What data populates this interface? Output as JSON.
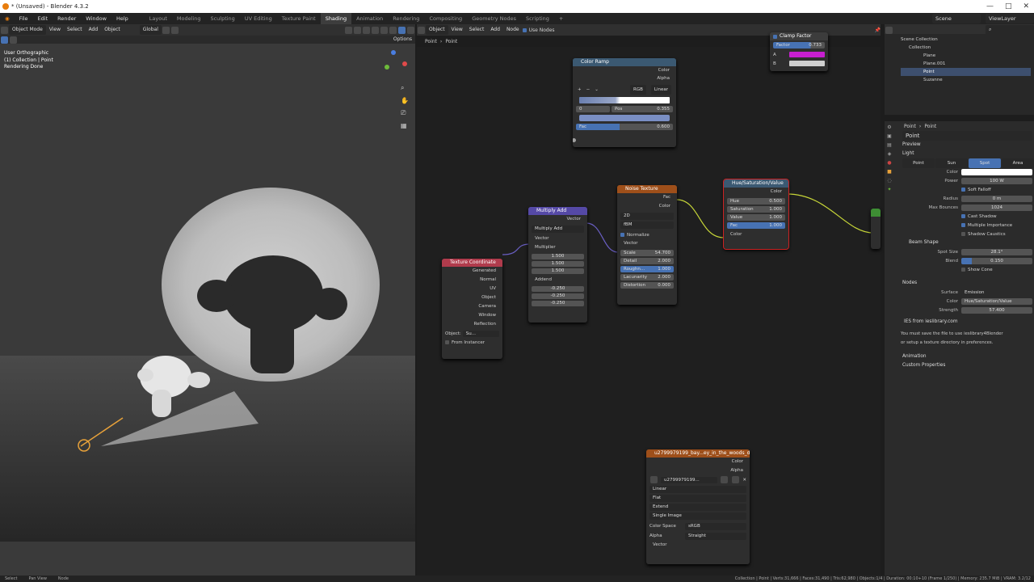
{
  "title": "* (Unsaved) - Blender 4.3.2",
  "menu": [
    "File",
    "Edit",
    "Render",
    "Window",
    "Help"
  ],
  "workspaces": [
    "Layout",
    "Modeling",
    "Sculpting",
    "UV Editing",
    "Texture Paint",
    "Shading",
    "Animation",
    "Rendering",
    "Compositing",
    "Geometry Nodes",
    "Scripting",
    "+"
  ],
  "active_workspace": "Shading",
  "scene": "Scene",
  "view_layer": "ViewLayer",
  "viewport": {
    "mode": "Object Mode",
    "menus": [
      "View",
      "Select",
      "Add",
      "Object"
    ],
    "orientation": "Global",
    "options": "Options",
    "info": [
      "User Orthographic",
      "(1) Collection | Point",
      "Rendering Done"
    ]
  },
  "node_editor": {
    "type": "Object",
    "menus": [
      "View",
      "Select",
      "Add",
      "Node"
    ],
    "use_nodes": "Use Nodes",
    "breadcrumb": [
      "Point",
      "Point"
    ]
  },
  "nodes": {
    "color_ramp": {
      "title": "Color Ramp",
      "out": [
        "Color",
        "Alpha"
      ],
      "mode": "RGB",
      "interp": "Linear",
      "index": "0",
      "pos_label": "Pos",
      "pos": "0.355",
      "fac_label": "Fac",
      "fac": "0.600",
      "ctrl": [
        "+",
        "−",
        "⌄"
      ]
    },
    "clamp": {
      "title": "Clamp Factor",
      "factor_label": "Factor",
      "factor": "0.733",
      "a": "A",
      "b": "B"
    },
    "multiply_add": {
      "title": "Multiply Add",
      "out": "Vector",
      "op": "Multiply Add",
      "vector": "Vector",
      "multiplier": "Multiplier",
      "mvals": [
        "1.500",
        "1.500",
        "1.500"
      ],
      "addend": "Addend",
      "avals": [
        "-0.250",
        "-0.250",
        "-0.250"
      ]
    },
    "texcoord": {
      "title": "Texture Coordinate",
      "outs": [
        "Generated",
        "Normal",
        "UV",
        "Object",
        "Camera",
        "Window",
        "Reflection"
      ],
      "object_label": "Object:",
      "object_val": "Su...",
      "from_instancer": "From Instancer"
    },
    "noise": {
      "title": "Noise Texture",
      "outs": [
        "Fac",
        "Color"
      ],
      "dim": "2D",
      "type": "fBM",
      "normalize": "Normalize",
      "vector": "Vector",
      "fields": [
        [
          "Scale",
          "54.700"
        ],
        [
          "Detail",
          "2.000"
        ],
        [
          "Roughn...",
          "1.000"
        ],
        [
          "Lacunarity",
          "2.000"
        ],
        [
          "Distortion",
          "0.000"
        ]
      ]
    },
    "hsv": {
      "title": "Hue/Saturation/Value",
      "out": "Color",
      "fields": [
        [
          "Hue",
          "0.500"
        ],
        [
          "Saturation",
          "1.000"
        ],
        [
          "Value",
          "1.000"
        ],
        [
          "Fac",
          "1.000"
        ]
      ],
      "in": "Color"
    },
    "image": {
      "title": "u2799979199_bay...ey_in_the_woods_d",
      "outs": [
        "Color",
        "Alpha"
      ],
      "img": "u2799979199...",
      "dds": [
        "Linear",
        "Flat",
        "Extend",
        "Single Image"
      ],
      "cs_label": "Color Space",
      "cs": "sRGB",
      "alpha_label": "Alpha",
      "alpha": "Straight",
      "vector": "Vector"
    }
  },
  "outliner": {
    "items": [
      "Scene Collection",
      "Collection",
      "Plane",
      "Plane.001",
      "Point",
      "Suzanne"
    ]
  },
  "properties": {
    "breadcrumb": [
      "Point",
      "Point"
    ],
    "name": "Point",
    "sections": {
      "preview": "Preview",
      "light": "Light",
      "beam": "Beam Shape",
      "nodes": "Nodes",
      "ies": "IES from ieslibrary.com",
      "anim": "Animation",
      "custom": "Custom Properties"
    },
    "light_types": [
      "Point",
      "Sun",
      "Spot",
      "Area"
    ],
    "active_type": "Spot",
    "color_label": "Color",
    "power_label": "Power",
    "power": "100 W",
    "soft_falloff": "Soft Falloff",
    "radius_label": "Radius",
    "radius": "0 m",
    "bounces_label": "Max Bounces",
    "bounces": "1024",
    "cast_shadow": "Cast Shadow",
    "mis": "Multiple Importance",
    "caustics": "Shadow Caustics",
    "spot_size_label": "Spot Size",
    "spot_size": "28.1°",
    "blend_label": "Blend",
    "blend": "0.150",
    "show_cone": "Show Cone",
    "surface_label": "Surface",
    "surface": "Emission",
    "ncolor_label": "Color",
    "ncolor": "Hue/Saturation/Value",
    "strength_label": "Strength",
    "strength": "57.400",
    "ies_text1": "You must save the file to use ieslibrary4Blender",
    "ies_text2": "or setup a texture directory in preferences."
  },
  "status": {
    "left": [
      "Select",
      "Pan View",
      "Node"
    ],
    "right": "Collection | Point | Verts:31,666 | Faces:31,490 | Tris:62,980 | Objects:1/4 | Duration: 00:10+10 (Frame 1/250) | Memory: 235.7 MiB | VRAM: 3.2/12"
  },
  "colors": {
    "accent": "#4772b3",
    "converter": "#3b5972",
    "texture": "#9e4f1a",
    "input": "#b03b4c",
    "vector": "#5549a6"
  }
}
